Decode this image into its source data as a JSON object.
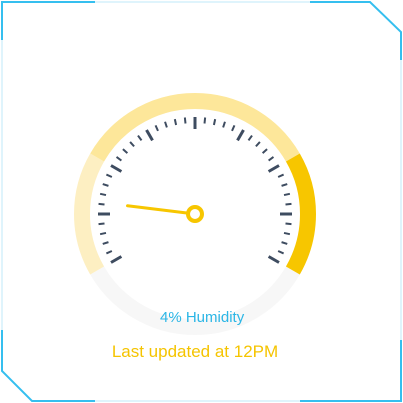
{
  "widget": {
    "humidity_label": "4% Humidity",
    "updated_label": "Last updated at 12PM",
    "humidity_value_percent": 4
  },
  "colors": {
    "frame": "#35bfef",
    "accent_light": "#fde79a",
    "accent_pale": "#fdefc2",
    "accent_strong": "#f7c600",
    "tick": "#3e4c60",
    "needle": "#f7c600",
    "humidity_text": "#2bb6e6",
    "updated_text": "#f5c400"
  }
}
